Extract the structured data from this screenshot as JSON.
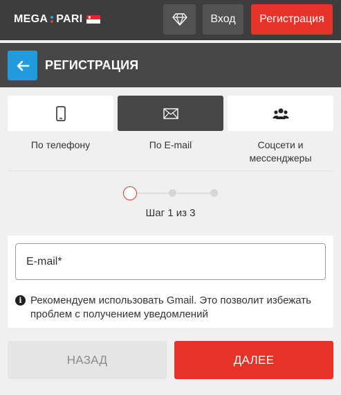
{
  "header": {
    "logo_left": "MEGA",
    "logo_right": "PARI",
    "login_label": "Вход",
    "register_label": "Регистрация",
    "icons": [
      "diamond-icon",
      "singapore-flag-icon"
    ]
  },
  "titlebar": {
    "title": "РЕГИСТРАЦИЯ",
    "back_icon": "arrow-left-icon"
  },
  "methods": [
    {
      "label": "По телефону",
      "icon": "smartphone-icon",
      "active": false
    },
    {
      "label": "По E-mail",
      "icon": "envelope-icon",
      "active": true
    },
    {
      "label": "Соцсети и мессенджеры",
      "icon": "users-icon",
      "active": false
    }
  ],
  "stepper": {
    "current": 1,
    "total": 3,
    "text": "Шаг 1 из 3"
  },
  "form": {
    "email_placeholder": "E-mail*",
    "email_value": "",
    "hint": "Рекомендуем использовать Gmail. Это позволит избежать проблем с получением уведомлений",
    "hint_icon": "info-icon"
  },
  "actions": {
    "back_label": "НАЗАД",
    "next_label": "ДАЛЕЕ"
  },
  "colors": {
    "accent_red": "#e5332a",
    "accent_blue": "#1f9bde",
    "header_bg": "#3d3d3d",
    "titlebar_bg": "#474747"
  }
}
